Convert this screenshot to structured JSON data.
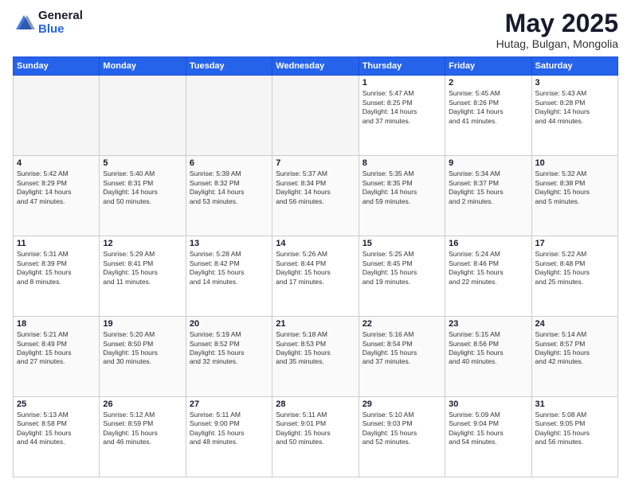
{
  "logo": {
    "general": "General",
    "blue": "Blue"
  },
  "title": "May 2025",
  "location": "Hutag, Bulgan, Mongolia",
  "weekdays": [
    "Sunday",
    "Monday",
    "Tuesday",
    "Wednesday",
    "Thursday",
    "Friday",
    "Saturday"
  ],
  "weeks": [
    [
      {
        "day": "",
        "info": ""
      },
      {
        "day": "",
        "info": ""
      },
      {
        "day": "",
        "info": ""
      },
      {
        "day": "",
        "info": ""
      },
      {
        "day": "1",
        "info": "Sunrise: 5:47 AM\nSunset: 8:25 PM\nDaylight: 14 hours\nand 37 minutes."
      },
      {
        "day": "2",
        "info": "Sunrise: 5:45 AM\nSunset: 8:26 PM\nDaylight: 14 hours\nand 41 minutes."
      },
      {
        "day": "3",
        "info": "Sunrise: 5:43 AM\nSunset: 8:28 PM\nDaylight: 14 hours\nand 44 minutes."
      }
    ],
    [
      {
        "day": "4",
        "info": "Sunrise: 5:42 AM\nSunset: 8:29 PM\nDaylight: 14 hours\nand 47 minutes."
      },
      {
        "day": "5",
        "info": "Sunrise: 5:40 AM\nSunset: 8:31 PM\nDaylight: 14 hours\nand 50 minutes."
      },
      {
        "day": "6",
        "info": "Sunrise: 5:39 AM\nSunset: 8:32 PM\nDaylight: 14 hours\nand 53 minutes."
      },
      {
        "day": "7",
        "info": "Sunrise: 5:37 AM\nSunset: 8:34 PM\nDaylight: 14 hours\nand 56 minutes."
      },
      {
        "day": "8",
        "info": "Sunrise: 5:35 AM\nSunset: 8:35 PM\nDaylight: 14 hours\nand 59 minutes."
      },
      {
        "day": "9",
        "info": "Sunrise: 5:34 AM\nSunset: 8:37 PM\nDaylight: 15 hours\nand 2 minutes."
      },
      {
        "day": "10",
        "info": "Sunrise: 5:32 AM\nSunset: 8:38 PM\nDaylight: 15 hours\nand 5 minutes."
      }
    ],
    [
      {
        "day": "11",
        "info": "Sunrise: 5:31 AM\nSunset: 8:39 PM\nDaylight: 15 hours\nand 8 minutes."
      },
      {
        "day": "12",
        "info": "Sunrise: 5:29 AM\nSunset: 8:41 PM\nDaylight: 15 hours\nand 11 minutes."
      },
      {
        "day": "13",
        "info": "Sunrise: 5:28 AM\nSunset: 8:42 PM\nDaylight: 15 hours\nand 14 minutes."
      },
      {
        "day": "14",
        "info": "Sunrise: 5:26 AM\nSunset: 8:44 PM\nDaylight: 15 hours\nand 17 minutes."
      },
      {
        "day": "15",
        "info": "Sunrise: 5:25 AM\nSunset: 8:45 PM\nDaylight: 15 hours\nand 19 minutes."
      },
      {
        "day": "16",
        "info": "Sunrise: 5:24 AM\nSunset: 8:46 PM\nDaylight: 15 hours\nand 22 minutes."
      },
      {
        "day": "17",
        "info": "Sunrise: 5:22 AM\nSunset: 8:48 PM\nDaylight: 15 hours\nand 25 minutes."
      }
    ],
    [
      {
        "day": "18",
        "info": "Sunrise: 5:21 AM\nSunset: 8:49 PM\nDaylight: 15 hours\nand 27 minutes."
      },
      {
        "day": "19",
        "info": "Sunrise: 5:20 AM\nSunset: 8:50 PM\nDaylight: 15 hours\nand 30 minutes."
      },
      {
        "day": "20",
        "info": "Sunrise: 5:19 AM\nSunset: 8:52 PM\nDaylight: 15 hours\nand 32 minutes."
      },
      {
        "day": "21",
        "info": "Sunrise: 5:18 AM\nSunset: 8:53 PM\nDaylight: 15 hours\nand 35 minutes."
      },
      {
        "day": "22",
        "info": "Sunrise: 5:16 AM\nSunset: 8:54 PM\nDaylight: 15 hours\nand 37 minutes."
      },
      {
        "day": "23",
        "info": "Sunrise: 5:15 AM\nSunset: 8:56 PM\nDaylight: 15 hours\nand 40 minutes."
      },
      {
        "day": "24",
        "info": "Sunrise: 5:14 AM\nSunset: 8:57 PM\nDaylight: 15 hours\nand 42 minutes."
      }
    ],
    [
      {
        "day": "25",
        "info": "Sunrise: 5:13 AM\nSunset: 8:58 PM\nDaylight: 15 hours\nand 44 minutes."
      },
      {
        "day": "26",
        "info": "Sunrise: 5:12 AM\nSunset: 8:59 PM\nDaylight: 15 hours\nand 46 minutes."
      },
      {
        "day": "27",
        "info": "Sunrise: 5:11 AM\nSunset: 9:00 PM\nDaylight: 15 hours\nand 48 minutes."
      },
      {
        "day": "28",
        "info": "Sunrise: 5:11 AM\nSunset: 9:01 PM\nDaylight: 15 hours\nand 50 minutes."
      },
      {
        "day": "29",
        "info": "Sunrise: 5:10 AM\nSunset: 9:03 PM\nDaylight: 15 hours\nand 52 minutes."
      },
      {
        "day": "30",
        "info": "Sunrise: 5:09 AM\nSunset: 9:04 PM\nDaylight: 15 hours\nand 54 minutes."
      },
      {
        "day": "31",
        "info": "Sunrise: 5:08 AM\nSunset: 9:05 PM\nDaylight: 15 hours\nand 56 minutes."
      }
    ]
  ]
}
